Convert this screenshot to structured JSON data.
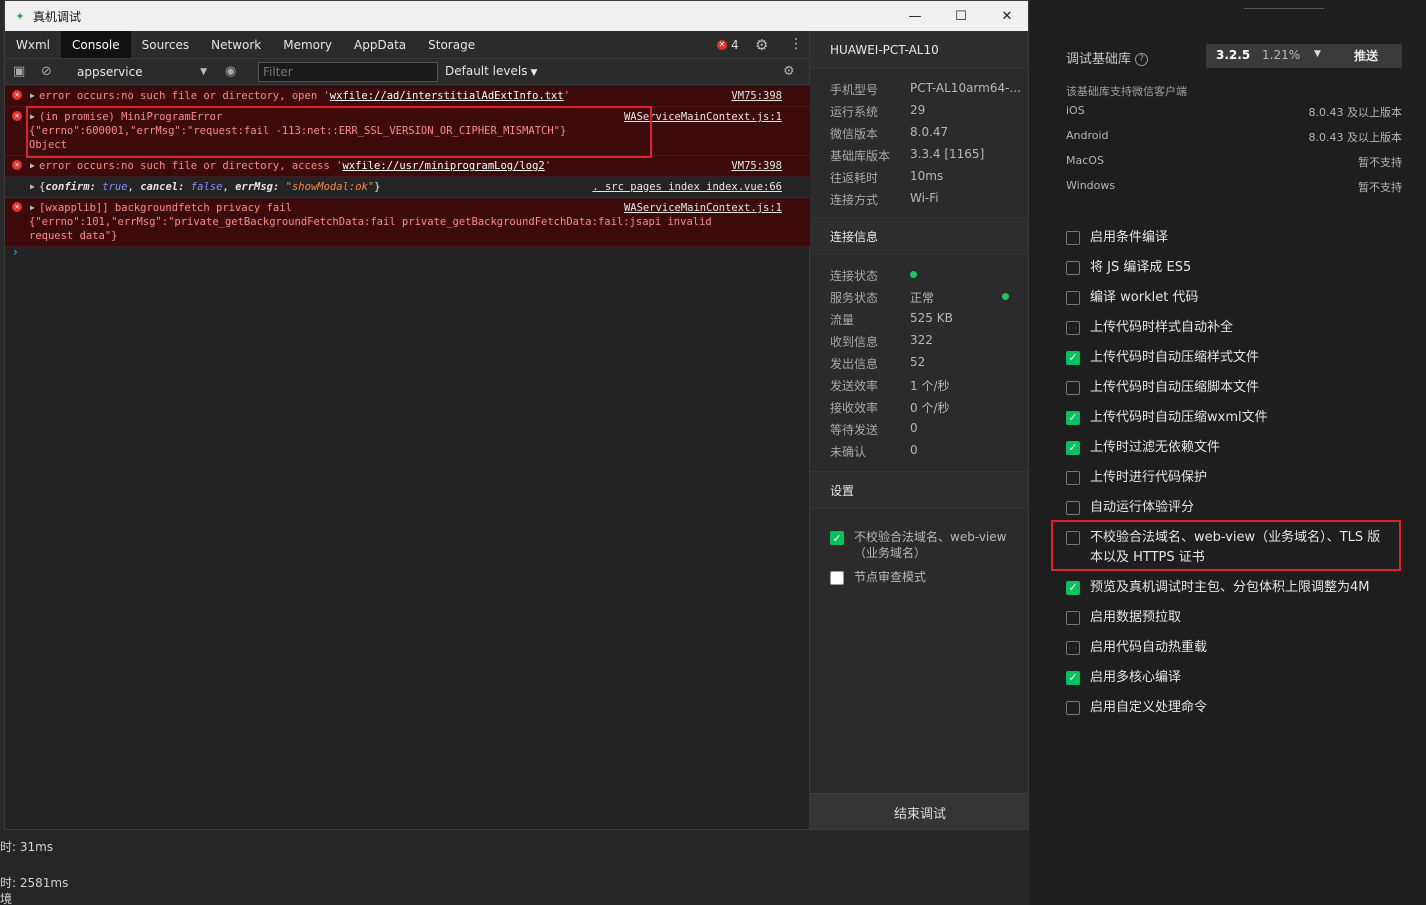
{
  "background": {
    "lines": [
      "时: 31ms",
      "时: 2581ms",
      "境"
    ]
  },
  "window": {
    "title": "真机调试",
    "controls": {
      "minimize": "—",
      "maximize": "☐",
      "close": "✕"
    }
  },
  "devtools": {
    "tabs": [
      "Wxml",
      "Console",
      "Sources",
      "Network",
      "Memory",
      "AppData",
      "Storage"
    ],
    "active_tab": "Console",
    "error_count": "4",
    "context": "appservice",
    "filter_placeholder": "Filter",
    "levels": "Default levels"
  },
  "console": {
    "rows": [
      {
        "type": "error",
        "pre": "error occurs:no such file or directory, open '",
        "link": "wxfile://ad/interstitialAdExtInfo.txt",
        "post": "'",
        "source": "VM75:398"
      },
      {
        "type": "error",
        "line1": "(in promise) MiniProgramError",
        "line2": "{\"errno\":600001,\"errMsg\":\"request:fail -113:net::ERR_SSL_VERSION_OR_CIPHER_MISMATCH\"}",
        "line3": "Object",
        "source": "WAServiceMainContext.js:1"
      },
      {
        "type": "error",
        "pre": "error occurs:no such file or directory, access '",
        "link": "wxfile://usr/miniprogramLog/log2",
        "post": "'",
        "source": "VM75:398"
      },
      {
        "type": "log",
        "k1": "confirm",
        "v1": "true",
        "k2": "cancel",
        "v2": "false",
        "k3": "errMsg",
        "v3": "\"showModal:ok\"",
        "source": ". src pages index index.vue:66"
      },
      {
        "type": "error",
        "line1": "[wxapplib]] backgroundfetch privacy fail",
        "line2": "{\"errno\":101,\"errMsg\":\"private_getBackgroundFetchData:fail private_getBackgroundFetchData:fail:jsapi invalid",
        "line3": "request data\"}",
        "source": "WAServiceMainContext.js:1"
      }
    ]
  },
  "device_panel": {
    "device_name": "HUAWEI-PCT-AL10",
    "info": [
      {
        "key": "手机型号",
        "value": "PCT-AL10arm64-..."
      },
      {
        "key": "运行系统",
        "value": "29"
      },
      {
        "key": "微信版本",
        "value": "8.0.47"
      },
      {
        "key": "基础库版本",
        "value": "3.3.4 [1165]"
      },
      {
        "key": "往返耗时",
        "value": "10ms"
      },
      {
        "key": "连接方式",
        "value": "Wi-Fi"
      }
    ],
    "connection_title": "连接信息",
    "connection": [
      {
        "key": "连接状态",
        "value": ""
      },
      {
        "key": "服务状态",
        "value": "正常"
      },
      {
        "key": "流量",
        "value": "525 KB"
      },
      {
        "key": "收到信息",
        "value": "322"
      },
      {
        "key": "发出信息",
        "value": "52"
      },
      {
        "key": "发送效率",
        "value": "1 个/秒"
      },
      {
        "key": "接收效率",
        "value": "0 个/秒"
      },
      {
        "key": "等待发送",
        "value": "0"
      },
      {
        "key": "未确认",
        "value": "0"
      }
    ],
    "settings_title": "设置",
    "settings": [
      {
        "label": "不校验合法域名、web-view（业务域名）",
        "checked": true
      },
      {
        "label": "节点审查模式",
        "checked": false
      }
    ],
    "end_button": "结束调试"
  },
  "settings_pane": {
    "lib_label": "调试基础库",
    "lib_version": "3.2.5",
    "lib_share": "1.21%",
    "push_button": "推送",
    "support_note": "该基础库支持微信客户端",
    "platforms": [
      {
        "name": "iOS",
        "value": "8.0.43 及以上版本"
      },
      {
        "name": "Android",
        "value": "8.0.43 及以上版本"
      },
      {
        "name": "MacOS",
        "value": "暂不支持"
      },
      {
        "name": "Windows",
        "value": "暂不支持"
      }
    ],
    "options": [
      {
        "label": "启用条件编译",
        "checked": false
      },
      {
        "label": "将 JS 编译成 ES5",
        "checked": false
      },
      {
        "label": "编译 worklet 代码",
        "checked": false
      },
      {
        "label": "上传代码时样式自动补全",
        "checked": false
      },
      {
        "label": "上传代码时自动压缩样式文件",
        "checked": true
      },
      {
        "label": "上传代码时自动压缩脚本文件",
        "checked": false
      },
      {
        "label": "上传代码时自动压缩wxml文件",
        "checked": true
      },
      {
        "label": "上传时过滤无依赖文件",
        "checked": true
      },
      {
        "label": "上传时进行代码保护",
        "checked": false
      },
      {
        "label": "自动运行体验评分",
        "checked": false
      },
      {
        "label": "不校验合法域名、web-view（业务域名）、TLS 版本以及 HTTPS 证书",
        "checked": false
      },
      {
        "label": "预览及真机调试时主包、分包体积上限调整为4M",
        "checked": true
      },
      {
        "label": "启用数据预拉取",
        "checked": false
      },
      {
        "label": "启用代码自动热重载",
        "checked": false
      },
      {
        "label": "启用多核心编译",
        "checked": true
      },
      {
        "label": "启用自定义处理命令",
        "checked": false
      }
    ]
  },
  "colors": {
    "accent_green": "#07c160",
    "error_red": "#e3342f",
    "highlight_box": "#e0202a"
  }
}
